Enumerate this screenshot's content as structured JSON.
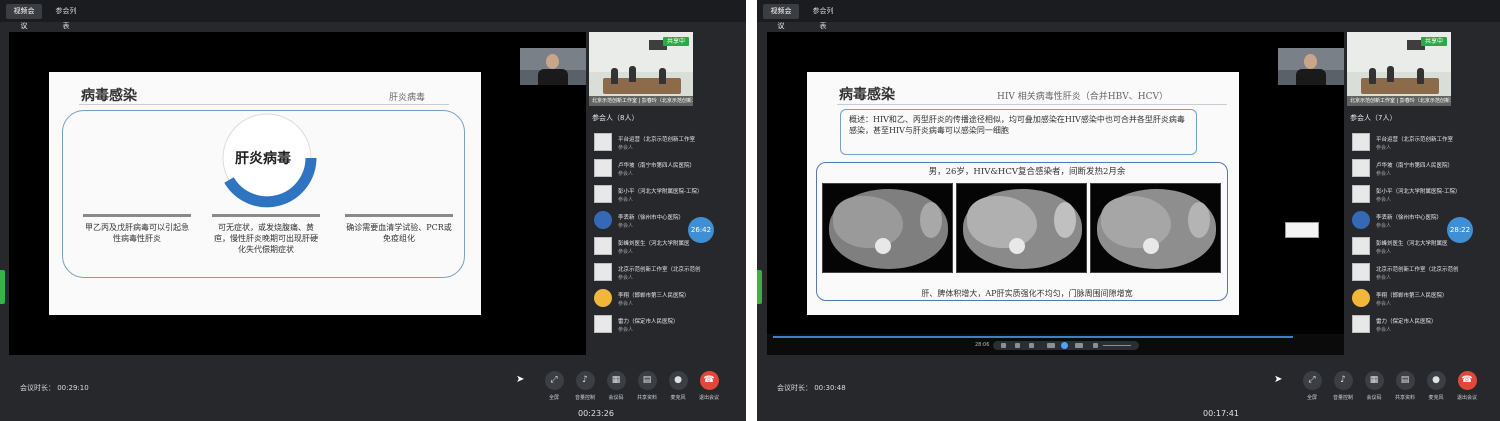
{
  "colors": {
    "accent_blue": "#3f8fd4",
    "leave_red": "#e2473a",
    "shared_green": "#2ca84a"
  },
  "left": {
    "tabs": [
      "视频会议",
      "参会列表"
    ],
    "slide": {
      "title": "病毒感染",
      "subtitle": "肝炎病毒",
      "ring_label": "肝炎病毒",
      "columns": [
        "甲乙丙及戊肝病毒可以引起急性病毒性肝炎",
        "可无症状，或发烧腹痛、黄疸，慢性肝炎晚期可出现肝硬化失代偿期症状",
        "确诊需要血清学试验、PCR或免疫组化"
      ]
    },
    "room_caption": "北京示范创新工作室 | 彭春玲（北京示范创新工作室）",
    "shared_badge": "共享中",
    "participants_title": "参会人（8人）",
    "participants": [
      {
        "name": "平台运营（北京示范创新工作室",
        "role": "参会人",
        "avatar": "blank"
      },
      {
        "name": "卢华坡（南宁市第四人民医院）",
        "role": "参会人",
        "avatar": "blank"
      },
      {
        "name": "彭小平（河北大学附属医院-工院）",
        "role": "参会人",
        "avatar": "blank"
      },
      {
        "name": "李丢新（徐州市中心医院）",
        "role": "参会人",
        "avatar": "photo"
      },
      {
        "name": "彭峰刘医生（河北大学附属医",
        "role": "参会人",
        "avatar": "blank"
      },
      {
        "name": "北京示范创新工作室（北京示范创",
        "role": "参会人",
        "avatar": "blank"
      },
      {
        "name": "李翔（邯郸市第三人民医院）",
        "role": "参会人",
        "avatar": "cartoon"
      },
      {
        "name": "雷力（保定市人民医院）",
        "role": "参会人",
        "avatar": "blank"
      }
    ],
    "timer": "26:42",
    "duration": "会议时长： 00:29:10",
    "bottom_time": "00:23:26"
  },
  "right": {
    "tabs": [
      "视频会议",
      "参会列表"
    ],
    "slide": {
      "title": "病毒感染",
      "subtitle": "HIV 相关病毒性肝炎（合并HBV、HCV）",
      "summary": "概述：HIV和乙、丙型肝炎的传播途径相似，均可叠加感染在HIV感染中也可合并各型肝炎病毒感染，甚至HIV与肝炎病毒可以感染同一细胞",
      "case_title": "男，26岁，HIV&HCV复合感染者，间断发热2月余",
      "finding": "肝、脾体积增大，AP肝实质强化不均匀，门脉周围间隙增宽"
    },
    "room_caption": "北京示范创新工作室 | 彭春玲（北京示范创新工作室）",
    "shared_badge": "共享中",
    "participants_title": "参会人（7人）",
    "participants": [
      {
        "name": "平台运营（北京示范创新工作室",
        "role": "参会人",
        "avatar": "blank"
      },
      {
        "name": "卢华坡（南宁市第四人民医院）",
        "role": "参会人",
        "avatar": "blank"
      },
      {
        "name": "彭小平（河北大学附属医院-工院）",
        "role": "参会人",
        "avatar": "blank"
      },
      {
        "name": "李丢新（徐州市中心医院）",
        "role": "参会人",
        "avatar": "photo"
      },
      {
        "name": "彭峰刘医生（河北大学附属医",
        "role": "参会人",
        "avatar": "blank"
      },
      {
        "name": "北京示范创新工作室（北京示范创",
        "role": "参会人",
        "avatar": "blank"
      },
      {
        "name": "李翔（邯郸市第三人民医院）",
        "role": "参会人",
        "avatar": "cartoon"
      },
      {
        "name": "雷力（保定市人民医院）",
        "role": "参会人",
        "avatar": "blank"
      }
    ],
    "timer": "28:22",
    "video_time_left": "28:06",
    "duration": "会议时长： 00:30:48",
    "bottom_time": "00:17:41"
  },
  "controls": [
    {
      "label": "全屏",
      "icon": "fullscreen-icon",
      "glyph": "⤢"
    },
    {
      "label": "音量控制",
      "icon": "volume-icon",
      "glyph": "🔊"
    },
    {
      "label": "会议码",
      "icon": "qrcode-icon",
      "glyph": "▦"
    },
    {
      "label": "共享资料",
      "icon": "document-icon",
      "glyph": "▤"
    },
    {
      "label": "麦克风",
      "icon": "microphone-icon",
      "glyph": "🎤"
    },
    {
      "label": "退出会议",
      "icon": "hangup-icon",
      "glyph": "☎"
    }
  ]
}
